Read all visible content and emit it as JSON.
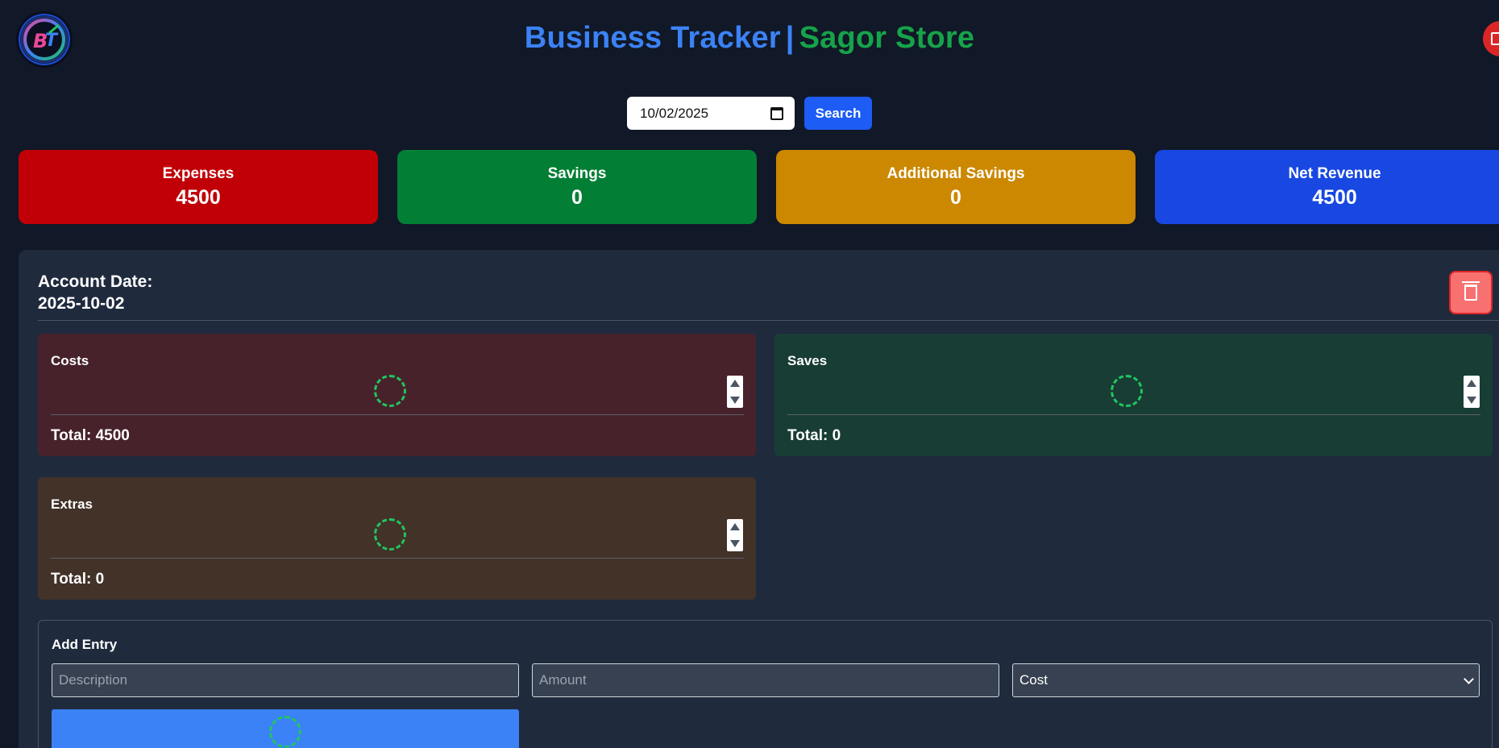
{
  "header": {
    "title_part1": "Business Tracker",
    "separator": "|",
    "title_part2": "Sagor Store"
  },
  "search": {
    "date_value": "10/02/2025",
    "button_label": "Search"
  },
  "stats": [
    {
      "label": "Expenses",
      "value": "4500",
      "color": "#c00006"
    },
    {
      "label": "Savings",
      "value": "0",
      "color": "#027f35"
    },
    {
      "label": "Additional Savings",
      "value": "0",
      "color": "#cc8800"
    },
    {
      "label": "Net Revenue",
      "value": "4500",
      "color": "#1848e1"
    }
  ],
  "account": {
    "date_label": "Account Date:",
    "date_value": "2025-10-02"
  },
  "boxes": {
    "costs": {
      "title": "Costs",
      "total": "Total: 4500",
      "bg": "#47222b"
    },
    "saves": {
      "title": "Saves",
      "total": "Total: 0",
      "bg": "#183d35"
    },
    "extras": {
      "title": "Extras",
      "total": "Total: 0",
      "bg": "#423228"
    }
  },
  "add_entry": {
    "title": "Add Entry",
    "description_placeholder": "Description",
    "amount_placeholder": "Amount",
    "type_selected": "Cost"
  }
}
